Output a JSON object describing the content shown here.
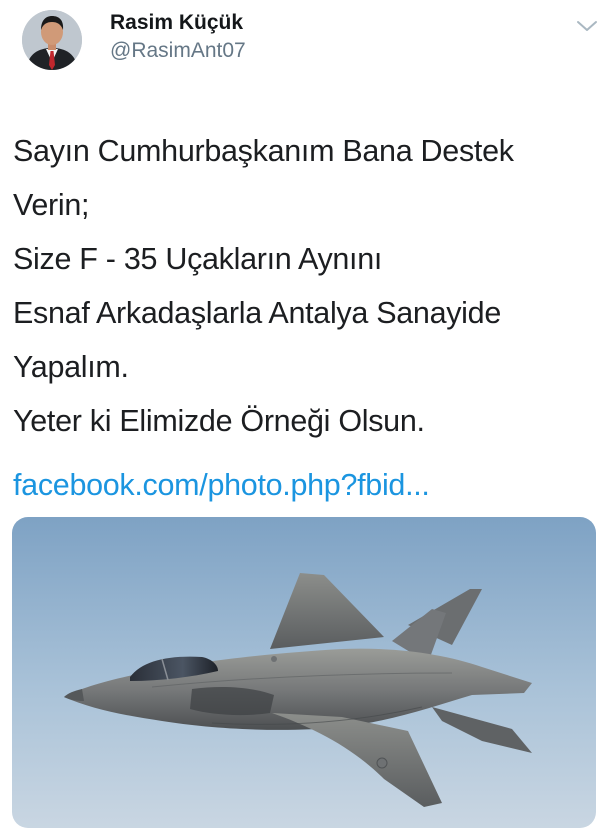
{
  "tweet": {
    "author": {
      "display_name": "Rasim Küçük",
      "handle": "@RasimAnt07",
      "avatar_icon": "user-portrait-icon"
    },
    "menu_icon": "chevron-down-icon",
    "text_lines": [
      "Sayın Cumhurbaşkanım Bana Destek",
      "Verin;",
      "Size F - 35 Uçakların Aynını",
      "Esnaf Arkadaşlarla Antalya Sanayide",
      "Yapalım.",
      "Yeter ki Elimizde Örneği Olsun."
    ],
    "link": "facebook.com/photo.php?fbid...",
    "media": {
      "subject": "jet-aircraft-photo"
    }
  },
  "colors": {
    "link": "#1b95e0",
    "handle": "#657786",
    "text": "#1c1e21"
  }
}
